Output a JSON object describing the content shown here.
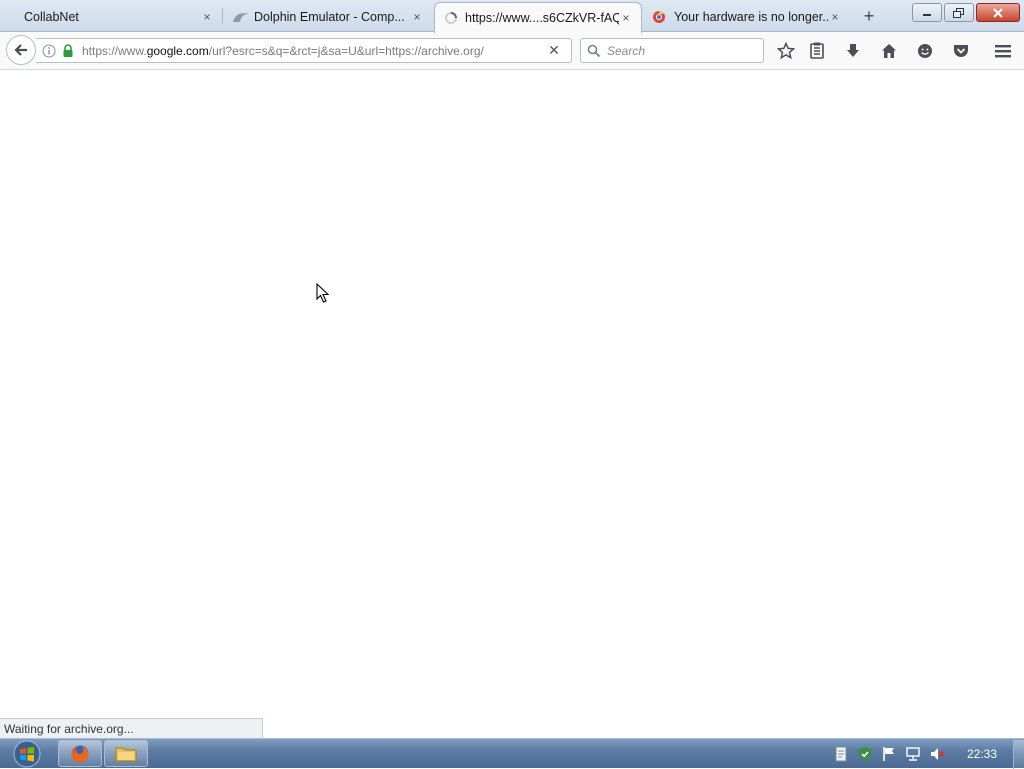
{
  "tabs": [
    {
      "label": "CollabNet",
      "close": "×"
    },
    {
      "label": "Dolphin Emulator - Comp...",
      "close": "×"
    },
    {
      "label": "https://www....s6CZkVR-fAQ",
      "close": "×"
    },
    {
      "label": "Your hardware is no longer...",
      "close": "×"
    }
  ],
  "new_tab_label": "+",
  "urlbar": {
    "scheme_prefix": "https://www.",
    "domain": "google.com",
    "path": "/url?esrc=s&q=&rct=j&sa=U&url=https://archive.org/",
    "stop_glyph": "✕"
  },
  "search": {
    "placeholder": "Search"
  },
  "status_text": "Waiting for archive.org...",
  "clock": "22:33",
  "colors": {
    "tab_strip": "#cfdbea",
    "taskbar": "#5c7ca4",
    "close_button": "#c7442f"
  },
  "icons": [
    "back-arrow-icon",
    "info-icon",
    "lock-icon",
    "search-icon",
    "bookmark-star-icon",
    "reading-list-icon",
    "download-icon",
    "home-icon",
    "hello-icon",
    "pocket-icon",
    "menu-icon",
    "windows-start-icon",
    "firefox-icon",
    "folder-icon"
  ]
}
